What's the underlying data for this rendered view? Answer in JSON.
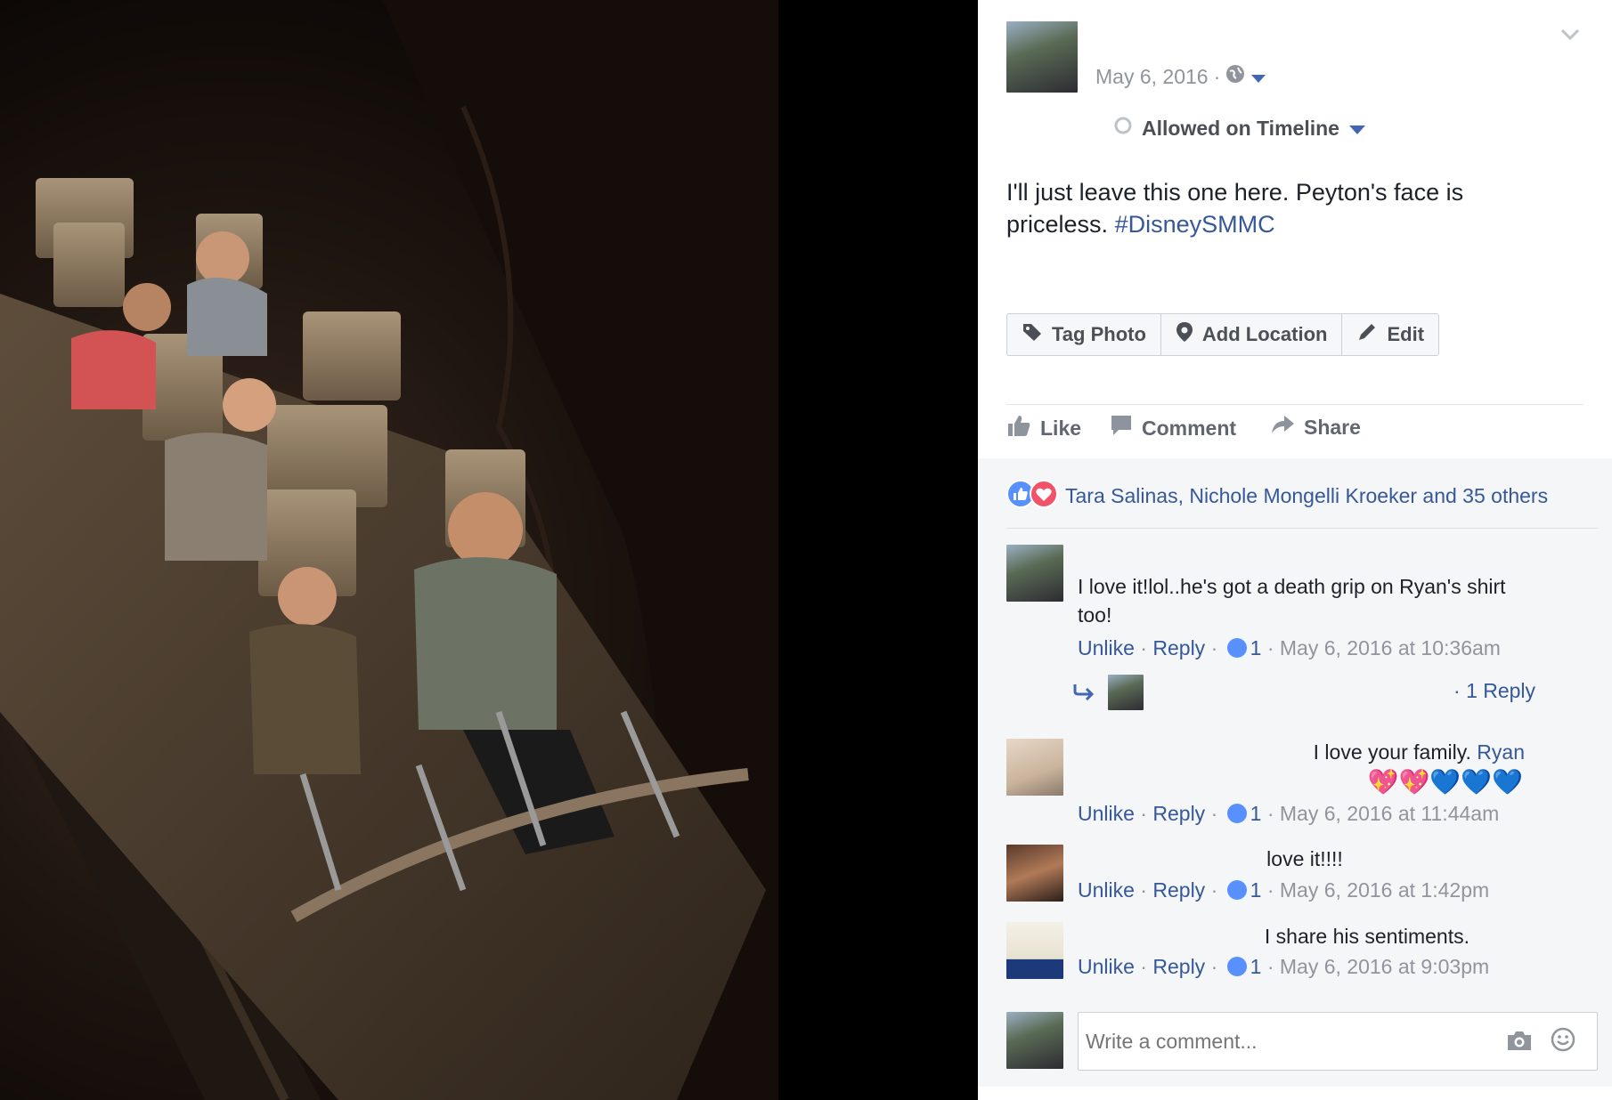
{
  "post": {
    "date": "May 6, 2016",
    "separator": "·",
    "timeline_status": "Allowed on Timeline",
    "text": "I'll just leave this one here. Peyton's face is priceless.",
    "hashtag": "#DisneySMMC"
  },
  "photo_actions": {
    "tag_photo": "Tag Photo",
    "add_location": "Add Location",
    "edit": "Edit"
  },
  "actions": {
    "like": "Like",
    "comment": "Comment",
    "share": "Share"
  },
  "reactions": {
    "summary": "Tara Salinas, Nichole Mongelli Kroeker and 35 others"
  },
  "comments": [
    {
      "text": "I love it!lol..he's got a death grip on Ryan's shirt too!",
      "unlike": "Unlike",
      "reply": "Reply",
      "likes": "1",
      "timestamp": "May 6, 2016 at 10:36am",
      "replies_link": "1 Reply"
    },
    {
      "text": "I love your family.",
      "mention": "Ryan",
      "emoji": "💖💖💙💙💙",
      "unlike": "Unlike",
      "reply": "Reply",
      "likes": "1",
      "timestamp": "May 6, 2016 at 11:44am"
    },
    {
      "text": "love it!!!!",
      "unlike": "Unlike",
      "reply": "Reply",
      "likes": "1",
      "timestamp": "May 6, 2016 at 1:42pm"
    },
    {
      "text": "I share his sentiments.",
      "unlike": "Unlike",
      "reply": "Reply",
      "likes": "1",
      "timestamp": "May 6, 2016 at 9:03pm"
    }
  ],
  "composer": {
    "placeholder": "Write a comment..."
  },
  "colors": {
    "link_blue": "#365899",
    "like_blue": "#5890ff",
    "love_red": "#f25268",
    "text_gray": "#90949c"
  },
  "icons": [
    "globe-icon",
    "audience-caret-icon",
    "timeline-status-icon",
    "tag-icon",
    "location-pin-icon",
    "pencil-icon",
    "thumbs-up-icon",
    "comment-bubble-icon",
    "share-arrow-icon",
    "like-reaction-icon",
    "love-reaction-icon",
    "reply-arrow-icon",
    "camera-icon",
    "smiley-icon",
    "chevron-down-icon"
  ]
}
